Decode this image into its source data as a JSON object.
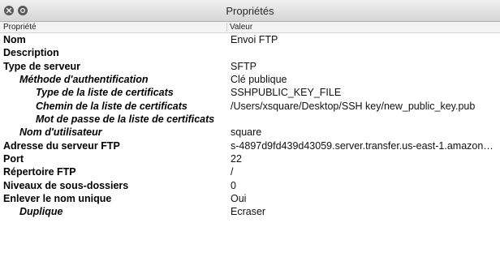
{
  "window": {
    "title": "Propriétés",
    "buttons": [
      {
        "name": "close-button",
        "icon": "close-icon"
      },
      {
        "name": "minimize-button",
        "icon": "minimize-icon"
      }
    ]
  },
  "columns": {
    "property": "Propriété",
    "value": "Valeur"
  },
  "rows": [
    {
      "property": "Nom",
      "value": "Envoi FTP",
      "level": 0
    },
    {
      "property": "Description",
      "value": "",
      "level": 0
    },
    {
      "property": "Type de serveur",
      "value": "SFTP",
      "level": 0
    },
    {
      "property": "Méthode d'authentification",
      "value": "Clé publique",
      "level": 1
    },
    {
      "property": "Type de la liste de certificats",
      "value": "SSHPUBLIC_KEY_FILE",
      "level": 2
    },
    {
      "property": "Chemin de la liste de certificats",
      "value": "/Users/xsquare/Desktop/SSH key/new_public_key.pub",
      "level": 2
    },
    {
      "property": "Mot de passe de la liste de certificats",
      "value": "",
      "level": 2
    },
    {
      "property": "Nom d'utilisateur",
      "value": "square",
      "level": 1
    },
    {
      "property": "Adresse du serveur FTP",
      "value": "s-4897d9fd439d43059.server.transfer.us-east-1.amazon…",
      "level": 0
    },
    {
      "property": "Port",
      "value": "22",
      "level": 0
    },
    {
      "property": "Répertoire FTP",
      "value": "/",
      "level": 0
    },
    {
      "property": "Niveaux de sous-dossiers",
      "value": "0",
      "level": 0
    },
    {
      "property": "Enlever le nom unique",
      "value": "Oui",
      "level": 0
    },
    {
      "property": "Duplique",
      "value": "Ecraser",
      "level": 1
    }
  ]
}
